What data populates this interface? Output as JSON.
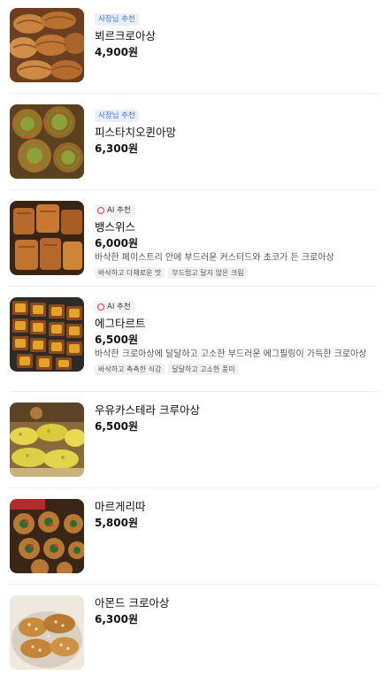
{
  "products": [
    {
      "name": "뵈르크로아상",
      "price": "4,900원",
      "badge_type": "owner",
      "badge": "사장님 추천",
      "image_desc": "croissants"
    },
    {
      "name": "피스타치오퀸아망",
      "price": "6,300원",
      "badge_type": "owner",
      "badge": "사장님 추천",
      "image_desc": "pistachio-kouign-amann"
    },
    {
      "name": "뱅스위스",
      "price": "6,000원",
      "badge_type": "ai",
      "badge": "AI 추천",
      "description": "바삭한 페이스트리 안에 부드러운 커스터드와 초코가 든 크로아상",
      "tags": [
        "바삭하고 다채로운 맛",
        "부드럽고 달지 않은 크림"
      ],
      "image_desc": "pain-suisse"
    },
    {
      "name": "에그타르트",
      "price": "6,500원",
      "badge_type": "ai",
      "badge": "AI 추천",
      "description": "바삭한 크로아상에 달달하고 고소한 부드러운 에그필링이 가득한 크로아상",
      "tags": [
        "바삭하고 촉촉한 식감",
        "달달하고 고소한 풍미"
      ],
      "image_desc": "egg-tart"
    },
    {
      "name": "우유카스테라 크루아상",
      "price": "6,500원",
      "image_desc": "milk-castella-croissant"
    },
    {
      "name": "마르게리따",
      "price": "5,800원",
      "image_desc": "margherita-pastry"
    },
    {
      "name": "아몬드 크로아상",
      "price": "6,300원",
      "image_desc": "almond-croissant"
    }
  ],
  "colors": {
    "owner_badge_text": "#3f6fd8",
    "owner_badge_bg": "#e9f0fc",
    "ai_ring": "#e83a6f"
  }
}
